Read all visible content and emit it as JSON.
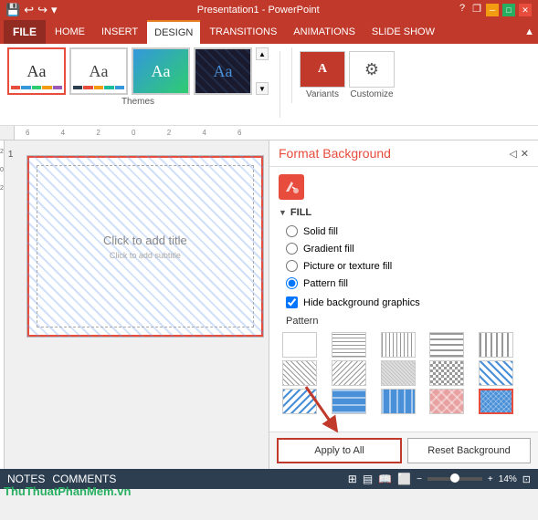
{
  "titlebar": {
    "title": "Presentation1 - PowerPoint",
    "help_icon": "?",
    "restore_icon": "❐",
    "minimize_icon": "─",
    "maximize_icon": "□",
    "close_icon": "✕"
  },
  "quickaccess": {
    "save_icon": "💾",
    "undo_icon": "↩",
    "redo_icon": "↪",
    "customize_icon": "▾"
  },
  "menubar": {
    "file": "FILE",
    "items": [
      "HOME",
      "INSERT",
      "DESIGN",
      "TRANSITIONS",
      "ANIMATIONS",
      "SLIDE SHOW"
    ]
  },
  "ribbon": {
    "themes_label": "Themes",
    "theme1_label": "Aa",
    "theme2_label": "Aa",
    "theme3_label": "Aa",
    "theme4_label": "Aa",
    "variants_label": "Variants",
    "customize_label": "Customize"
  },
  "ruler": {
    "ticks": [
      "6",
      "4",
      "2",
      "0",
      "2",
      "4",
      "6"
    ]
  },
  "slide": {
    "number": "1",
    "add_title": "Click to add title",
    "add_subtitle": "Click to add subtitle"
  },
  "panel": {
    "title": "Format Background",
    "fill_section": "FILL",
    "solid_fill": "Solid fill",
    "gradient_fill": "Gradient fill",
    "picture_fill": "Picture or texture fill",
    "pattern_fill": "Pattern fill",
    "hide_bg": "Hide background graphics",
    "pattern_label": "Pattern",
    "apply_all_btn": "Apply to All",
    "reset_btn": "Reset Background"
  },
  "statusbar": {
    "notes": "NOTES",
    "comments": "COMMENTS",
    "zoom": "14%"
  }
}
